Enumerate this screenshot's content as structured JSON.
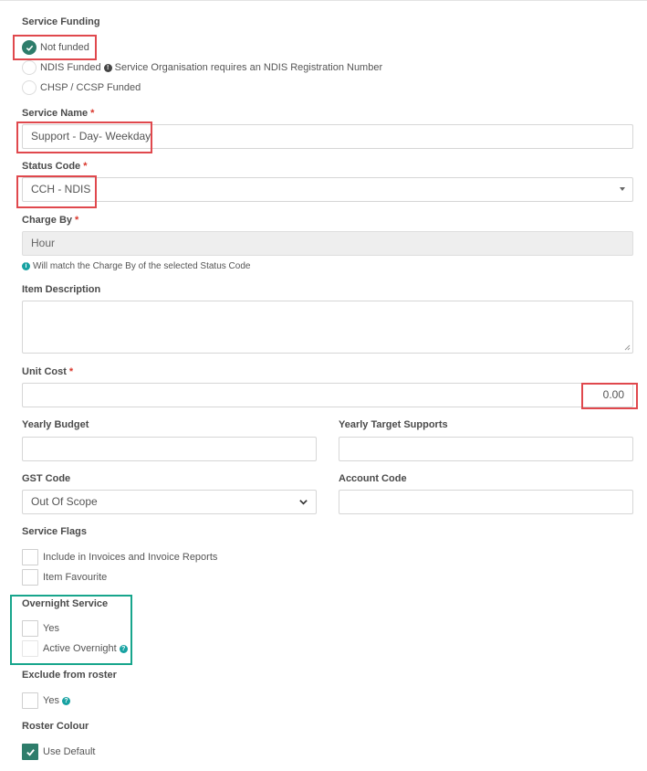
{
  "service_funding": {
    "label": "Service Funding",
    "options": [
      {
        "label": "Not funded",
        "checked": true
      },
      {
        "label": "NDIS Funded",
        "checked": false,
        "note": "Service Organisation requires an NDIS Registration Number"
      },
      {
        "label": "CHSP / CCSP Funded",
        "checked": false
      }
    ]
  },
  "service_name": {
    "label": "Service Name",
    "required_mark": "*",
    "value": "Support - Day- Weekday"
  },
  "status_code": {
    "label": "Status Code",
    "required_mark": "*",
    "value": "CCH - NDIS"
  },
  "charge_by": {
    "label": "Charge By",
    "required_mark": "*",
    "value": "Hour",
    "hint": "Will match the Charge By of the selected Status Code"
  },
  "item_description": {
    "label": "Item Description",
    "value": ""
  },
  "unit_cost": {
    "label": "Unit Cost",
    "required_mark": "*",
    "value": "0.00"
  },
  "yearly_budget": {
    "label": "Yearly Budget",
    "value": ""
  },
  "yearly_target_supports": {
    "label": "Yearly Target Supports",
    "value": ""
  },
  "gst_code": {
    "label": "GST Code",
    "value": "Out Of Scope"
  },
  "account_code": {
    "label": "Account Code",
    "value": ""
  },
  "service_flags": {
    "label": "Service Flags",
    "items": [
      {
        "label": "Include in Invoices and Invoice Reports",
        "checked": false
      },
      {
        "label": "Item Favourite",
        "checked": false
      }
    ]
  },
  "overnight_service": {
    "label": "Overnight Service",
    "items": [
      {
        "label": "Yes",
        "checked": false
      },
      {
        "label": "Active Overnight",
        "checked": false
      }
    ]
  },
  "exclude_from_roster": {
    "label": "Exclude from roster",
    "yes_label": "Yes",
    "checked": false
  },
  "roster_colour": {
    "label": "Roster Colour",
    "use_default_label": "Use Default",
    "checked": true
  },
  "colors": {
    "accent": "#2e7d6b",
    "required": "#d9362b",
    "highlight_red": "#e0484d",
    "highlight_teal": "#17a58c",
    "info": "#17a2a2"
  }
}
